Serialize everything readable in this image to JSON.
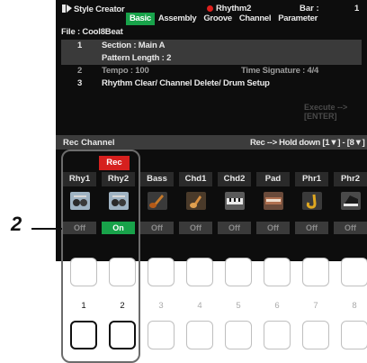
{
  "header": {
    "app_title": "Style Creator",
    "style_name": "Rhythm2",
    "bar_label": "Bar :",
    "bar_value": "1"
  },
  "tabs": [
    {
      "label": "Basic",
      "active": true
    },
    {
      "label": "Assembly",
      "active": false
    },
    {
      "label": "Groove",
      "active": false
    },
    {
      "label": "Channel",
      "active": false
    },
    {
      "label": "Parameter",
      "active": false
    }
  ],
  "file": "File : Cool8Beat",
  "rows": {
    "r1_num": "1",
    "r1_text": "Section : Main A",
    "r1b_text": "Pattern Length : 2",
    "r2_num": "2",
    "r2_text": "Tempo : 100",
    "r2_ts": "Time Signature : 4/4",
    "r3_num": "3",
    "r3_text": "Rhythm Clear/ Channel Delete/ Drum Setup"
  },
  "execute": "Execute --> [ENTER]",
  "rec_channel": {
    "label": "Rec Channel",
    "hint": "Rec --> Hold down [1▼] - [8▼]",
    "rec_badge": "Rec"
  },
  "channels": [
    {
      "name": "Rhy1",
      "status": "Off",
      "icon": "drum-kit-icon",
      "on": false
    },
    {
      "name": "Rhy2",
      "status": "On",
      "icon": "drum-kit-icon",
      "on": true
    },
    {
      "name": "Bass",
      "status": "Off",
      "icon": "bass-guitar-icon",
      "on": false
    },
    {
      "name": "Chd1",
      "status": "Off",
      "icon": "guitar-icon",
      "on": false
    },
    {
      "name": "Chd2",
      "status": "Off",
      "icon": "keyboard-icon",
      "on": false
    },
    {
      "name": "Pad",
      "status": "Off",
      "icon": "organ-icon",
      "on": false
    },
    {
      "name": "Phr1",
      "status": "Off",
      "icon": "saxophone-icon",
      "on": false
    },
    {
      "name": "Phr2",
      "status": "Off",
      "icon": "piano-icon",
      "on": false
    }
  ],
  "button_numbers": [
    "1",
    "2",
    "3",
    "4",
    "5",
    "6",
    "7",
    "8"
  ],
  "callout": "2"
}
